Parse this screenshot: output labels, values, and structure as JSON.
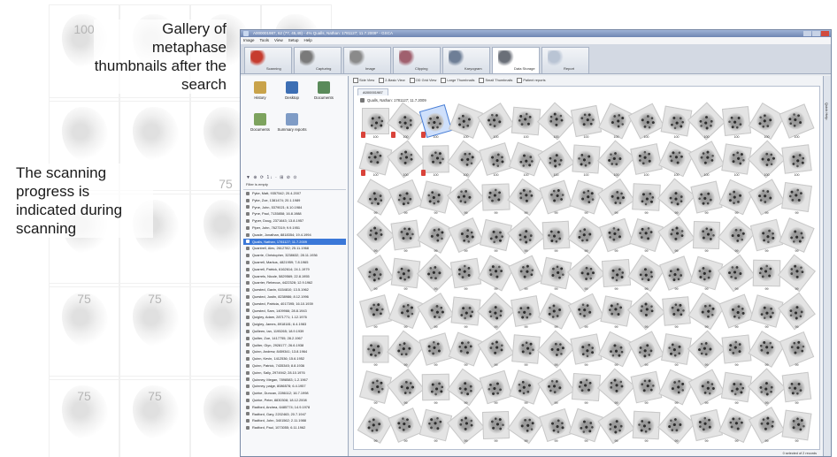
{
  "background_scores": [
    "100",
    "75",
    "75",
    "75",
    "75",
    "75",
    "75"
  ],
  "captions": {
    "gallery": "Gallery of metaphase thumbnails after the search",
    "scanning": "The scanning progress is indicated during scanning"
  },
  "window": {
    "title": "A000001987, 62 (77, 45,49) - 4% Qualls, Nathan: 1781127; 11.7.2009* - GSCA",
    "menu": [
      "Image",
      "Tools",
      "View",
      "Setup",
      "Help"
    ]
  },
  "tabs": [
    {
      "label": "Scanning",
      "icon": "scanning-icon"
    },
    {
      "label": "Capturing",
      "icon": "capturing-icon"
    },
    {
      "label": "Image",
      "icon": "image-icon"
    },
    {
      "label": "Clipping",
      "icon": "clipping-icon"
    },
    {
      "label": "Karyogram",
      "icon": "karyogram-icon"
    },
    {
      "label": "Data Storage",
      "icon": "data-storage-icon"
    },
    {
      "label": "Report",
      "icon": "report-icon"
    }
  ],
  "left_panel": {
    "buttons": [
      "History",
      "Desktop",
      "Documents",
      "Documents",
      "Summary reports"
    ],
    "toolbar": "▼ ⊕ ⟳ 1↓ · ⊞ ⊘ ⊙",
    "filter_text": "Filter is empty",
    "patients": [
      "Pyke, Matt, 9357542; 20.4.2007",
      "Pyke, Zoe, 1381474; 20.1.1989",
      "Pyne, John, 5379021; 6.10.1984",
      "Pyne, Paul, 7135858; 16.8.1988",
      "Pyper, Doug, 2371643; 13.8.1957",
      "Piper, John, 7627319; 9.9.1951",
      "Quade, Jonathan, 8818354; 19.4.1994",
      "Qualls, Nathan, 1781127; 11.7.2009",
      "Quantrell, Alec, 2612782; 25.11.1968",
      "Quarrie, Christopher, 3238632; 28.11.1936",
      "Quarrell, Markus, 4821959; 7.8.1965",
      "Quarrell, Patrick, 6162614; 24.1.1979",
      "Quarrels, Nicole, 5829569; 22.8.1955",
      "Quarrier, Rebecca, 4422328; 12.9.1962",
      "Quested, Gavin, 6154810; 13.5.1962",
      "Quested, Justin, 8238986; 8.12.1996",
      "Quested, Patricia, 4017395; 16.10.1939",
      "Quested, Sam, 1409966; 28.8.1943",
      "Quigley, Adam, 2871771; 1.12.1976",
      "Quigley, James, 8918181; 6.4.1983",
      "Quilleen, Ian, 1195265; 18.9.1939",
      "Quilter, Zoe, 1417755; 28.2.1967",
      "Quilter, Glyn, 2928177; 26.6.1938",
      "Quinn, Andrew, 8459341; 13.8.1964",
      "Quinn, Kevin, 1412536; 15.6.1952",
      "Quinn, Patrick, 7435345; 8.8.1936",
      "Quinn, Sally, 2974942; 28.10.1976",
      "Quinney, Megan, 7898583; 1.2.1967",
      "Quinney, paige, 8086578; 6.4.1957",
      "Quirke, Duncan, 2286112; 16.7.1998",
      "Quirke, Peter, 8830308; 18.12.2008",
      "Radford, Andrea, 6485774; 14.9.1978",
      "Radford, Gary, 2202463; 20.7.1947",
      "Radford, John, 3401562; 2.11.1988",
      "Radford, Paul, 1073055; 6.11.1962"
    ]
  },
  "view_toolbar": [
    "Side View",
    "2-Basic View",
    "OD Grid View",
    "Large Thumbnails",
    "Small Thumbnails",
    "Patient reports"
  ],
  "gallery": {
    "doc_tab": "A000001987",
    "case_label": "Qualls, Nathan: 1781127; 11.7.2009",
    "rows": 9,
    "cols": 15,
    "flagged_rows": 2,
    "selected_index": 2
  },
  "scores": {
    "row_1": "100",
    "row_2": "100",
    "rest": "99"
  },
  "status": "0 selected of 2 records",
  "side_strip": "Quick Help"
}
